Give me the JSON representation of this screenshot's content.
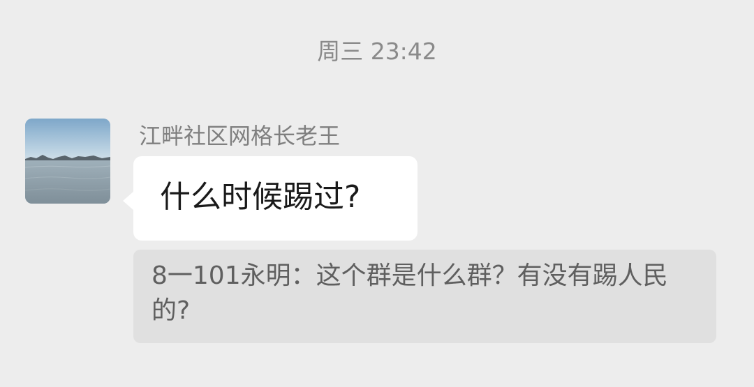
{
  "timestamp": "周三 23:42",
  "message": {
    "sender_name": "江畔社区网格长老王",
    "avatar_icon": "landscape-avatar-icon",
    "text": "什么时候踢过?"
  },
  "quote": {
    "text": "8一101永明：这个群是什么群？有没有踢人民的?"
  },
  "colors": {
    "background": "#ededed",
    "bubble": "#ffffff",
    "quote_background": "#e0e0e0",
    "secondary_text": "#8a8a8a"
  }
}
